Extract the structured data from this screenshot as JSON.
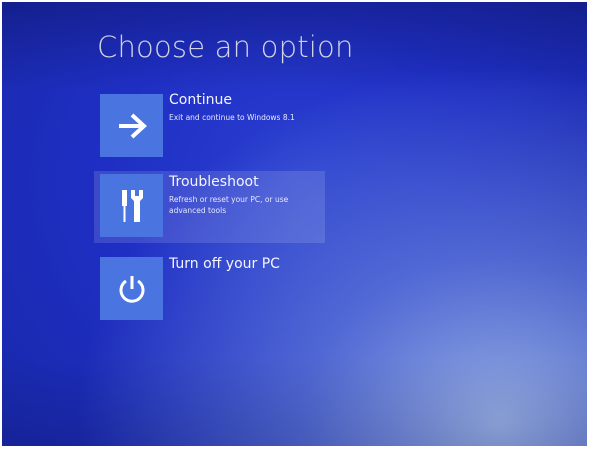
{
  "screen": {
    "title": "Choose an option"
  },
  "options": [
    {
      "label": "Continue",
      "description": "Exit and continue to Windows 8.1",
      "icon": "arrow-right-icon"
    },
    {
      "label": "Troubleshoot",
      "description": "Refresh or reset your PC, or use advanced tools",
      "icon": "tools-icon"
    },
    {
      "label": "Turn off your PC",
      "description": "",
      "icon": "power-icon"
    }
  ],
  "colors": {
    "background": "#1f2fc4",
    "tile": "#4a74e0",
    "text": "#ffffff"
  }
}
